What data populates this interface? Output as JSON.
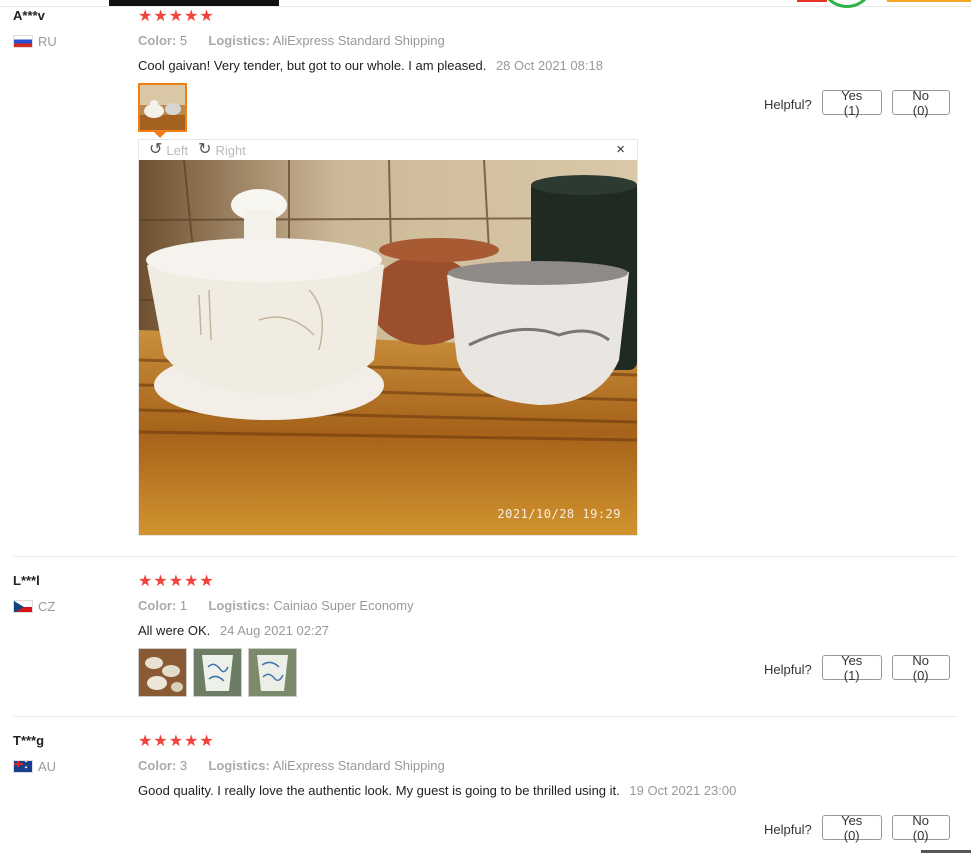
{
  "reviews": [
    {
      "user": "A***v",
      "country_code": "RU",
      "stars": "★★★★★",
      "color_label": "Color:",
      "color_value": "5",
      "logistics_label": "Logistics:",
      "logistics_value": "AliExpress Standard Shipping",
      "text": "Cool gaivan! Very tender, but got to our whole. I am pleased.",
      "date": "28 Oct 2021 08:18",
      "helpful_label": "Helpful?",
      "yes_label": "Yes (1)",
      "no_label": "No (0)"
    },
    {
      "user": "L***l",
      "country_code": "CZ",
      "stars": "★★★★★",
      "color_label": "Color:",
      "color_value": "1",
      "logistics_label": "Logistics:",
      "logistics_value": "Cainiao Super Economy",
      "text": "All were OK.",
      "date": "24 Aug 2021 02:27",
      "helpful_label": "Helpful?",
      "yes_label": "Yes (1)",
      "no_label": "No (0)"
    },
    {
      "user": "T***g",
      "country_code": "AU",
      "stars": "★★★★★",
      "color_label": "Color:",
      "color_value": "3",
      "logistics_label": "Logistics:",
      "logistics_value": "AliExpress Standard Shipping",
      "text": "Good quality. I really love the authentic look. My guest is going to be thrilled using it.",
      "date": "19 Oct 2021 23:00",
      "helpful_label": "Helpful?",
      "yes_label": "Yes (0)",
      "no_label": "No (0)"
    }
  ],
  "viewer": {
    "rotate_left_label": "Left",
    "rotate_right_label": "Right",
    "close_symbol": "×",
    "timestamp": "2021/10/28  19:29",
    "icons": [
      "rotate-left-icon",
      "rotate-right-icon",
      "close-icon"
    ]
  },
  "colors": {
    "star": "#f0433b",
    "active_thumb_border": "#f07f16"
  }
}
